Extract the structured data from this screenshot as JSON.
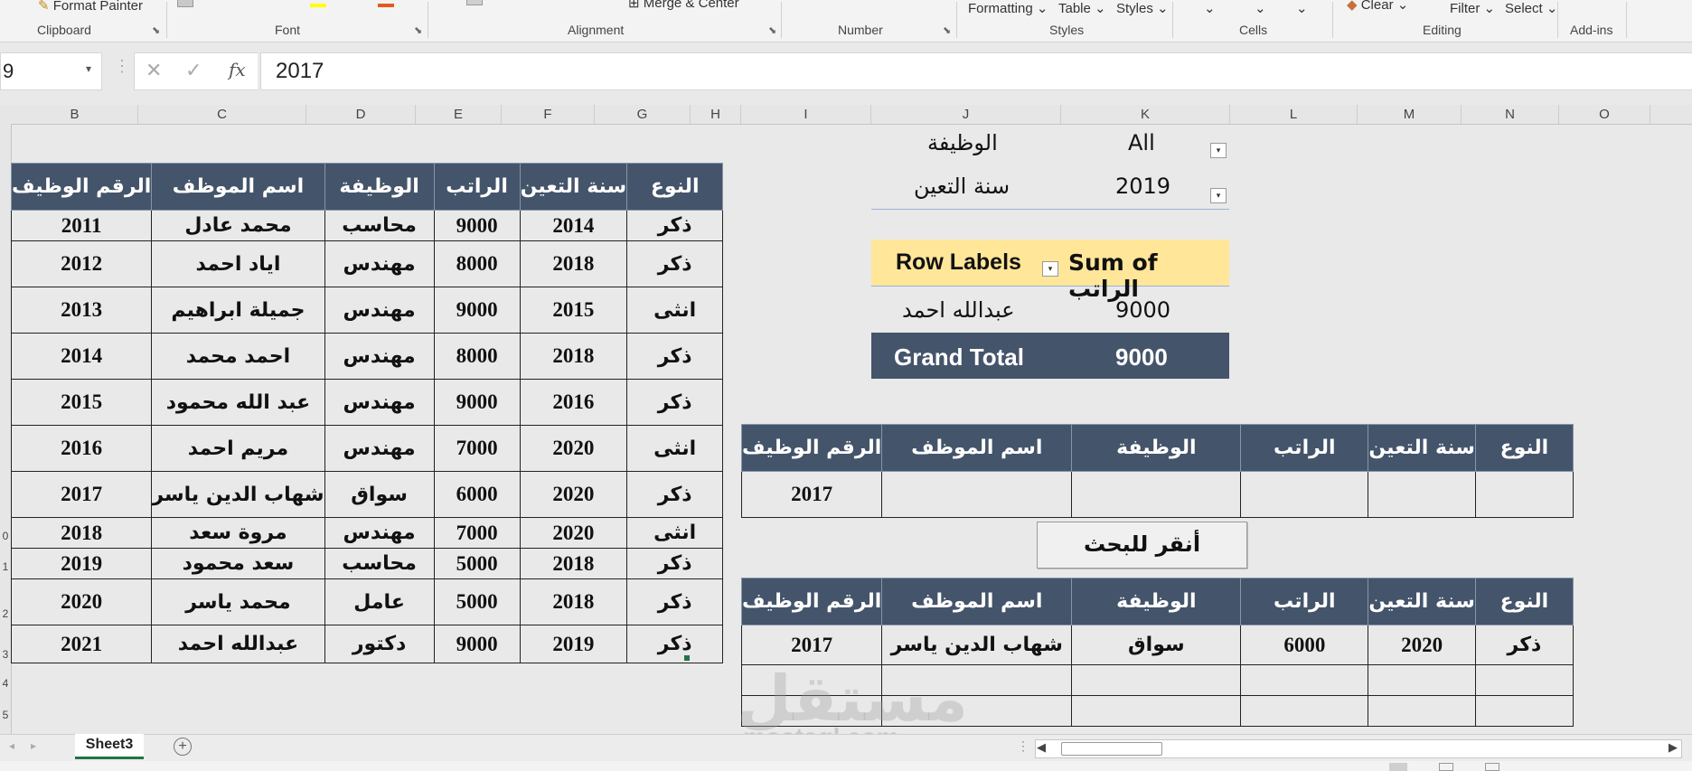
{
  "ribbon": {
    "format_painter": "Format Painter",
    "merge_center": "Merge & Center",
    "formatting": "Formatting",
    "table": "Table",
    "styles_btn": "Styles",
    "clear": "Clear",
    "filter": "Filter",
    "select": "Select",
    "groups": {
      "clipboard": "Clipboard",
      "font": "Font",
      "alignment": "Alignment",
      "number": "Number",
      "styles": "Styles",
      "cells": "Cells",
      "editing": "Editing",
      "addins": "Add-ins"
    }
  },
  "formula_bar": {
    "name_box": "9",
    "fx": "fx",
    "value": "2017"
  },
  "columns": [
    "B",
    "C",
    "D",
    "E",
    "F",
    "G",
    "H",
    "I",
    "J",
    "K",
    "L",
    "M",
    "N",
    "O"
  ],
  "row_numbers": [
    "0",
    "1",
    "2",
    "3",
    "4",
    "5"
  ],
  "source_table": {
    "headers": [
      "الرقم الوظيف",
      "اسم الموظف",
      "الوظيفة",
      "الراتب",
      "سنة التعين",
      "النوع"
    ],
    "rows": [
      [
        "2011",
        "محمد عادل",
        "محاسب",
        "9000",
        "2014",
        "ذكر"
      ],
      [
        "2012",
        "اياد احمد",
        "مهندس",
        "8000",
        "2018",
        "ذكر"
      ],
      [
        "2013",
        "جميلة ابراهيم",
        "مهندس",
        "9000",
        "2015",
        "انثى"
      ],
      [
        "2014",
        "احمد محمد",
        "مهندس",
        "8000",
        "2018",
        "ذكر"
      ],
      [
        "2015",
        "عبد الله محمود",
        "مهندس",
        "9000",
        "2016",
        "ذكر"
      ],
      [
        "2016",
        "مريم احمد",
        "مهندس",
        "7000",
        "2020",
        "انثى"
      ],
      [
        "2017",
        "شهاب الدين ياسر",
        "سواق",
        "6000",
        "2020",
        "ذكر"
      ],
      [
        "2018",
        "مروة سعد",
        "مهندس",
        "7000",
        "2020",
        "انثى"
      ],
      [
        "2019",
        "سعد محمود",
        "محاسب",
        "5000",
        "2018",
        "ذكر"
      ],
      [
        "2020",
        "محمد ياسر",
        "عامل",
        "5000",
        "2018",
        "ذكر"
      ],
      [
        "2021",
        "عبدالله احمد",
        "دكتور",
        "9000",
        "2019",
        "ذكر"
      ]
    ]
  },
  "pivot": {
    "filter1_label": "الوظيفة",
    "filter1_value": "All",
    "filter2_label": "سنة التعين",
    "filter2_value": "2019",
    "row_labels": "Row Labels",
    "sum_header": "Sum of الراتب",
    "row_name": "عبدالله احمد",
    "row_value": "9000",
    "grand_total_label": "Grand Total",
    "grand_total_value": "9000"
  },
  "search_table": {
    "headers": [
      "الرقم الوظيف",
      "اسم الموظف",
      "الوظيفة",
      "الراتب",
      "سنة التعين",
      "النوع"
    ],
    "input": [
      "2017",
      "",
      "",
      "",
      "",
      ""
    ]
  },
  "search_button": "أنقر للبحث",
  "result_table": {
    "headers": [
      "الرقم الوظيف",
      "اسم الموظف",
      "الوظيفة",
      "الراتب",
      "سنة التعين",
      "النوع"
    ],
    "rows": [
      [
        "2017",
        "شهاب الدين ياسر",
        "سواق",
        "6000",
        "2020",
        "ذكر"
      ]
    ]
  },
  "watermark": {
    "arabic": "مستقل",
    "latin": "mostaql.com"
  },
  "sheet_tab": "Sheet3",
  "colors": {
    "header_bg": "#44546a",
    "pivot_header_bg": "#ffe699",
    "excel_green": "#217346"
  }
}
